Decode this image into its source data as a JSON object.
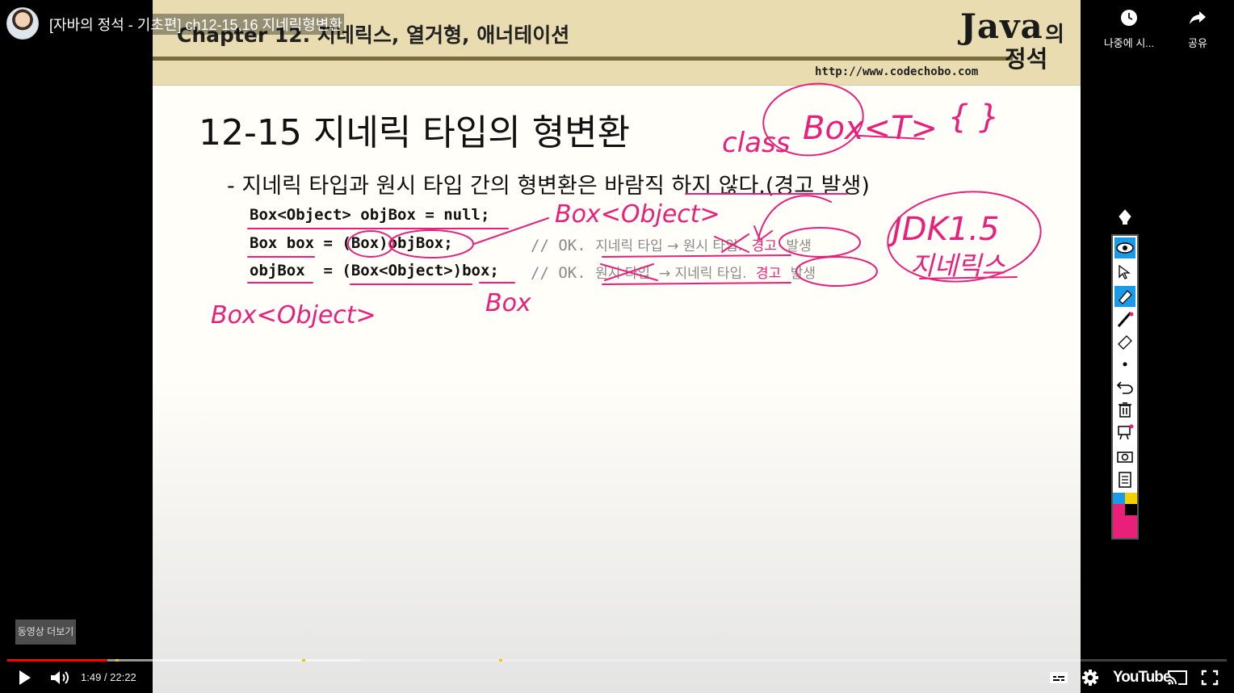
{
  "video": {
    "title": "[자바의 정석 - 기초편] ch12-15,16 지네릭형변환",
    "watch_later_label": "나중에 시...",
    "share_label": "공유",
    "more_videos_label": "동영상 더보기",
    "current_time": "1:49",
    "duration": "22:22",
    "time_display": "1:49 / 22:22",
    "progress_fraction": 0.082,
    "buffered_fraction": 0.29,
    "brand": "YouTube",
    "accent_color": "#ff0000"
  },
  "slide": {
    "chapter": "Chapter 12. 지네릭스, 열거형, 애너테이션",
    "logo_java": "Java",
    "logo_ui": "의",
    "logo_jeongseok": "정석",
    "url": "http://www.codechobo.com",
    "title": "12-15 지네릭 타입의 형변환",
    "bullet": "- 지네릭 타입과 원시 타입 간의 형변환은 바람직 하지 않다.(경고 발생)",
    "code_lines": [
      {
        "code": "Box<Object> objBox = null;",
        "comment_prefix": "",
        "comment_text": "",
        "warn": "",
        "tail": ""
      },
      {
        "code": "Box box = (Box)objBox;",
        "comment_prefix": "// OK.",
        "comment_text": "지네릭 타입 → 원시 타입.",
        "warn": "경고",
        "tail": "발생"
      },
      {
        "code": "objBox  = (Box<Object>)box;",
        "comment_prefix": "// OK.",
        "comment_text": "원시 타입  → 지네릭 타입.",
        "warn": "경고",
        "tail": "발생"
      }
    ],
    "annotations": {
      "class_word": "class",
      "class_generic": "Box<T>",
      "braces": "{  }",
      "box_object_top": "Box<Object>",
      "jdk": "JDK1.5",
      "generics": "지네릭스",
      "box_object_left": "Box<Object>",
      "box_under": "Box"
    },
    "ink_color": "#e8207a"
  },
  "pen_toolbar": {
    "tools": [
      "pen-nib-icon",
      "eye-icon",
      "cursor-icon",
      "highlighter-icon",
      "pen-icon",
      "eraser-icon",
      "dot-icon",
      "undo-icon",
      "trash-icon",
      "presentation-icon",
      "camera-icon",
      "clipboard-icon"
    ],
    "palette": [
      "#1a9be8",
      "#f5d000",
      "#e8207a",
      "#000000"
    ]
  }
}
